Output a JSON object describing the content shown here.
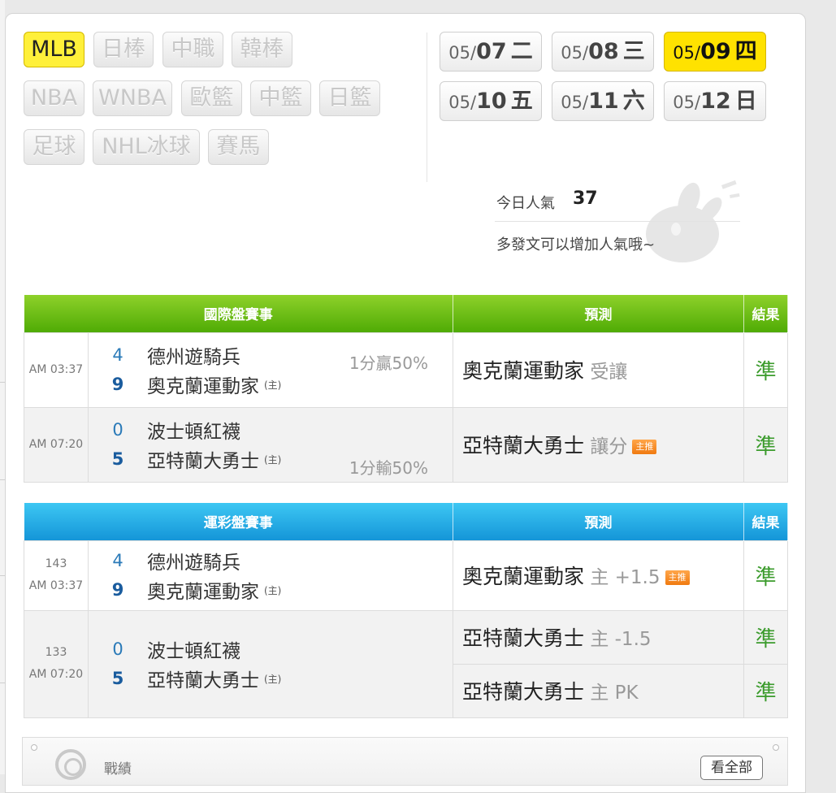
{
  "categories": [
    {
      "label": "MLB",
      "active": true
    },
    {
      "label": "日棒"
    },
    {
      "label": "中職"
    },
    {
      "label": "韓棒"
    },
    {
      "label": "NBA"
    },
    {
      "label": "WNBA"
    },
    {
      "label": "歐籃"
    },
    {
      "label": "中籃"
    },
    {
      "label": "日籃"
    },
    {
      "label": "足球"
    },
    {
      "label": "NHL冰球"
    },
    {
      "label": "賽馬"
    }
  ],
  "dates": [
    {
      "month": "05/",
      "day": "07",
      "weekday": "二"
    },
    {
      "month": "05/",
      "day": "08",
      "weekday": "三"
    },
    {
      "month": "05/",
      "day": "09",
      "weekday": "四",
      "active": true
    },
    {
      "month": "05/",
      "day": "10",
      "weekday": "五"
    },
    {
      "month": "05/",
      "day": "11",
      "weekday": "六"
    },
    {
      "month": "05/",
      "day": "12",
      "weekday": "日"
    }
  ],
  "popularity": {
    "label": "今日人氣",
    "value": "37",
    "tip": "多發文可以增加人氣哦~"
  },
  "intl": {
    "head_games": "國際盤賽事",
    "head_pred": "預測",
    "head_result": "結果",
    "rows": [
      {
        "time": "AM 03:37",
        "away_score": "4",
        "away": "德州遊騎兵",
        "home_score": "9",
        "home": "奧克蘭運動家",
        "home_mark": "(主)",
        "odds_top": "1分贏50%",
        "odds_bottom": "",
        "pred_team": "奧克蘭運動家",
        "pred_extra": " 受讓",
        "badge": "",
        "result": "準"
      },
      {
        "time": "AM 07:20",
        "away_score": "0",
        "away": "波士頓紅襪",
        "home_score": "5",
        "home": "亞特蘭大勇士",
        "home_mark": "(主)",
        "odds_top": "",
        "odds_bottom": "1分輸50%",
        "pred_team": "亞特蘭大勇士",
        "pred_extra": " 讓分",
        "badge": "主推",
        "result": "準"
      }
    ]
  },
  "sports": {
    "head_games": "運彩盤賽事",
    "head_pred": "預測",
    "head_result": "結果",
    "rows": [
      {
        "num": "143",
        "time": "AM 03:37",
        "away_score": "4",
        "away": "德州遊騎兵",
        "home_score": "9",
        "home": "奧克蘭運動家",
        "home_mark": "(主)",
        "preds": [
          {
            "team": "奧克蘭運動家",
            "extra": " 主 +1.5",
            "badge": "主推",
            "result": "準"
          }
        ]
      },
      {
        "num": "133",
        "time": "AM 07:20",
        "away_score": "0",
        "away": "波士頓紅襪",
        "home_score": "5",
        "home": "亞特蘭大勇士",
        "home_mark": "(主)",
        "preds": [
          {
            "team": "亞特蘭大勇士",
            "extra": " 主 -1.5",
            "badge": "",
            "result": "準"
          },
          {
            "team": "亞特蘭大勇士",
            "extra": " 主 PK",
            "badge": "",
            "result": "準"
          }
        ]
      }
    ]
  },
  "footer": {
    "label": "戰績",
    "button": "看全部"
  },
  "colors": {
    "accent_yellow": "#ffe200",
    "green_header": "#5ab80c",
    "blue_header": "#1ea6e2",
    "result_green": "#3b9b2c"
  }
}
